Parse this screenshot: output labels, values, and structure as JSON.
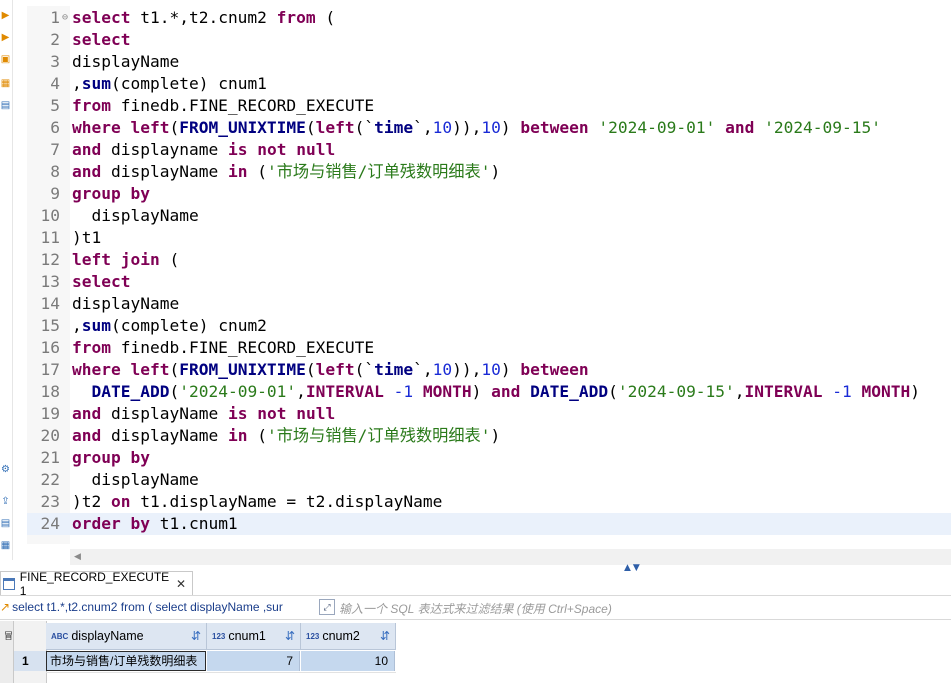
{
  "editor": {
    "current_line": 24,
    "lines": [
      {
        "n": "1",
        "fold": "⊖",
        "tokens": [
          {
            "t": "select",
            "c": "kw"
          },
          {
            "t": " t1.*,t2.cnum2 ",
            "c": ""
          },
          {
            "t": "from",
            "c": "kw"
          },
          {
            "t": " (",
            "c": ""
          }
        ]
      },
      {
        "n": "2",
        "tokens": [
          {
            "t": "select",
            "c": "kw"
          }
        ]
      },
      {
        "n": "3",
        "tokens": [
          {
            "t": "displayName",
            "c": ""
          }
        ]
      },
      {
        "n": "4",
        "tokens": [
          {
            "t": ",",
            "c": ""
          },
          {
            "t": "sum",
            "c": "fn"
          },
          {
            "t": "(complete) cnum1",
            "c": ""
          }
        ]
      },
      {
        "n": "5",
        "tokens": [
          {
            "t": "from",
            "c": "kw"
          },
          {
            "t": " finedb.FINE_RECORD_EXECUTE",
            "c": ""
          }
        ]
      },
      {
        "n": "6",
        "tokens": [
          {
            "t": "where",
            "c": "kw"
          },
          {
            "t": " ",
            "c": ""
          },
          {
            "t": "left",
            "c": "kw"
          },
          {
            "t": "(",
            "c": ""
          },
          {
            "t": "FROM_UNIXTIME",
            "c": "fn"
          },
          {
            "t": "(",
            "c": ""
          },
          {
            "t": "left",
            "c": "kw"
          },
          {
            "t": "(`",
            "c": ""
          },
          {
            "t": "time",
            "c": "fn"
          },
          {
            "t": "`,",
            "c": ""
          },
          {
            "t": "10",
            "c": "num"
          },
          {
            "t": ")),",
            "c": ""
          },
          {
            "t": "10",
            "c": "num"
          },
          {
            "t": ") ",
            "c": ""
          },
          {
            "t": "between",
            "c": "kw"
          },
          {
            "t": " ",
            "c": ""
          },
          {
            "t": "'2024-09-01'",
            "c": "str"
          },
          {
            "t": " ",
            "c": ""
          },
          {
            "t": "and",
            "c": "kw"
          },
          {
            "t": " ",
            "c": ""
          },
          {
            "t": "'2024-09-15'",
            "c": "str"
          }
        ]
      },
      {
        "n": "7",
        "tokens": [
          {
            "t": "and",
            "c": "kw"
          },
          {
            "t": " displayname ",
            "c": ""
          },
          {
            "t": "is",
            "c": "kw"
          },
          {
            "t": " ",
            "c": ""
          },
          {
            "t": "not",
            "c": "kw"
          },
          {
            "t": " ",
            "c": ""
          },
          {
            "t": "null",
            "c": "kw"
          }
        ]
      },
      {
        "n": "8",
        "tokens": [
          {
            "t": "and",
            "c": "kw"
          },
          {
            "t": " displayName ",
            "c": ""
          },
          {
            "t": "in",
            "c": "kw"
          },
          {
            "t": " (",
            "c": ""
          },
          {
            "t": "'市场与销售/订单残数明细表'",
            "c": "str"
          },
          {
            "t": ")",
            "c": ""
          }
        ]
      },
      {
        "n": "9",
        "tokens": [
          {
            "t": "group by",
            "c": "kw"
          }
        ]
      },
      {
        "n": "10",
        "tokens": [
          {
            "t": "  displayName",
            "c": ""
          }
        ]
      },
      {
        "n": "11",
        "tokens": [
          {
            "t": ")t1",
            "c": ""
          }
        ]
      },
      {
        "n": "12",
        "tokens": [
          {
            "t": "left join",
            "c": "kw"
          },
          {
            "t": " (",
            "c": ""
          }
        ]
      },
      {
        "n": "13",
        "tokens": [
          {
            "t": "select",
            "c": "kw"
          }
        ]
      },
      {
        "n": "14",
        "tokens": [
          {
            "t": "displayName",
            "c": ""
          }
        ]
      },
      {
        "n": "15",
        "tokens": [
          {
            "t": ",",
            "c": ""
          },
          {
            "t": "sum",
            "c": "fn"
          },
          {
            "t": "(complete) cnum2",
            "c": ""
          }
        ]
      },
      {
        "n": "16",
        "tokens": [
          {
            "t": "from",
            "c": "kw"
          },
          {
            "t": " finedb.FINE_RECORD_EXECUTE",
            "c": ""
          }
        ]
      },
      {
        "n": "17",
        "tokens": [
          {
            "t": "where",
            "c": "kw"
          },
          {
            "t": " ",
            "c": ""
          },
          {
            "t": "left",
            "c": "kw"
          },
          {
            "t": "(",
            "c": ""
          },
          {
            "t": "FROM_UNIXTIME",
            "c": "fn"
          },
          {
            "t": "(",
            "c": ""
          },
          {
            "t": "left",
            "c": "kw"
          },
          {
            "t": "(`",
            "c": ""
          },
          {
            "t": "time",
            "c": "fn"
          },
          {
            "t": "`,",
            "c": ""
          },
          {
            "t": "10",
            "c": "num"
          },
          {
            "t": ")),",
            "c": ""
          },
          {
            "t": "10",
            "c": "num"
          },
          {
            "t": ") ",
            "c": ""
          },
          {
            "t": "between",
            "c": "kw"
          }
        ]
      },
      {
        "n": "18",
        "tokens": [
          {
            "t": "  ",
            "c": ""
          },
          {
            "t": "DATE_ADD",
            "c": "fn"
          },
          {
            "t": "(",
            "c": ""
          },
          {
            "t": "'2024-09-01'",
            "c": "str"
          },
          {
            "t": ",",
            "c": ""
          },
          {
            "t": "INTERVAL",
            "c": "kw"
          },
          {
            "t": " ",
            "c": ""
          },
          {
            "t": "-1",
            "c": "num"
          },
          {
            "t": " ",
            "c": ""
          },
          {
            "t": "MONTH",
            "c": "kw"
          },
          {
            "t": ") ",
            "c": ""
          },
          {
            "t": "and",
            "c": "kw"
          },
          {
            "t": " ",
            "c": ""
          },
          {
            "t": "DATE_ADD",
            "c": "fn"
          },
          {
            "t": "(",
            "c": ""
          },
          {
            "t": "'2024-09-15'",
            "c": "str"
          },
          {
            "t": ",",
            "c": ""
          },
          {
            "t": "INTERVAL",
            "c": "kw"
          },
          {
            "t": " ",
            "c": ""
          },
          {
            "t": "-1",
            "c": "num"
          },
          {
            "t": " ",
            "c": ""
          },
          {
            "t": "MONTH",
            "c": "kw"
          },
          {
            "t": ")",
            "c": ""
          }
        ]
      },
      {
        "n": "19",
        "tokens": [
          {
            "t": "and",
            "c": "kw"
          },
          {
            "t": " displayName ",
            "c": ""
          },
          {
            "t": "is",
            "c": "kw"
          },
          {
            "t": " ",
            "c": ""
          },
          {
            "t": "not",
            "c": "kw"
          },
          {
            "t": " ",
            "c": ""
          },
          {
            "t": "null",
            "c": "kw"
          }
        ]
      },
      {
        "n": "20",
        "tokens": [
          {
            "t": "and",
            "c": "kw"
          },
          {
            "t": " displayName ",
            "c": ""
          },
          {
            "t": "in",
            "c": "kw"
          },
          {
            "t": " (",
            "c": ""
          },
          {
            "t": "'市场与销售/订单残数明细表'",
            "c": "str"
          },
          {
            "t": ")",
            "c": ""
          }
        ]
      },
      {
        "n": "21",
        "tokens": [
          {
            "t": "group by",
            "c": "kw"
          }
        ]
      },
      {
        "n": "22",
        "tokens": [
          {
            "t": "  displayName",
            "c": ""
          }
        ]
      },
      {
        "n": "23",
        "tokens": [
          {
            "t": ")t2 ",
            "c": ""
          },
          {
            "t": "on",
            "c": "kw"
          },
          {
            "t": " t1.displayName = t2.displayName",
            "c": ""
          }
        ]
      },
      {
        "n": "24",
        "tokens": [
          {
            "t": "order by",
            "c": "kw"
          },
          {
            "t": " t1.cnum1",
            "c": ""
          }
        ]
      }
    ]
  },
  "results": {
    "tab_label": "FINE_RECORD_EXECUTE 1",
    "tab_close": "✕",
    "query_preview": "select t1.*,t2.cnum2 from ( select displayName ,sur",
    "filter_placeholder": "输入一个 SQL 表达式来过滤结果 (使用 Ctrl+Space)",
    "side_label": "冒",
    "columns": [
      {
        "type": "ABC",
        "name": "displayName"
      },
      {
        "type": "123",
        "name": "cnum1"
      },
      {
        "type": "123",
        "name": "cnum2"
      }
    ],
    "rows": [
      {
        "row": "1",
        "cells": [
          "市场与销售/订单残数明细表",
          "7",
          "10"
        ]
      }
    ]
  },
  "colors": {
    "keyword": "#7f0055",
    "function": "#000080",
    "string": "#2a7a1a",
    "number": "#1a2bd6",
    "selection": "#c5d8ee"
  }
}
